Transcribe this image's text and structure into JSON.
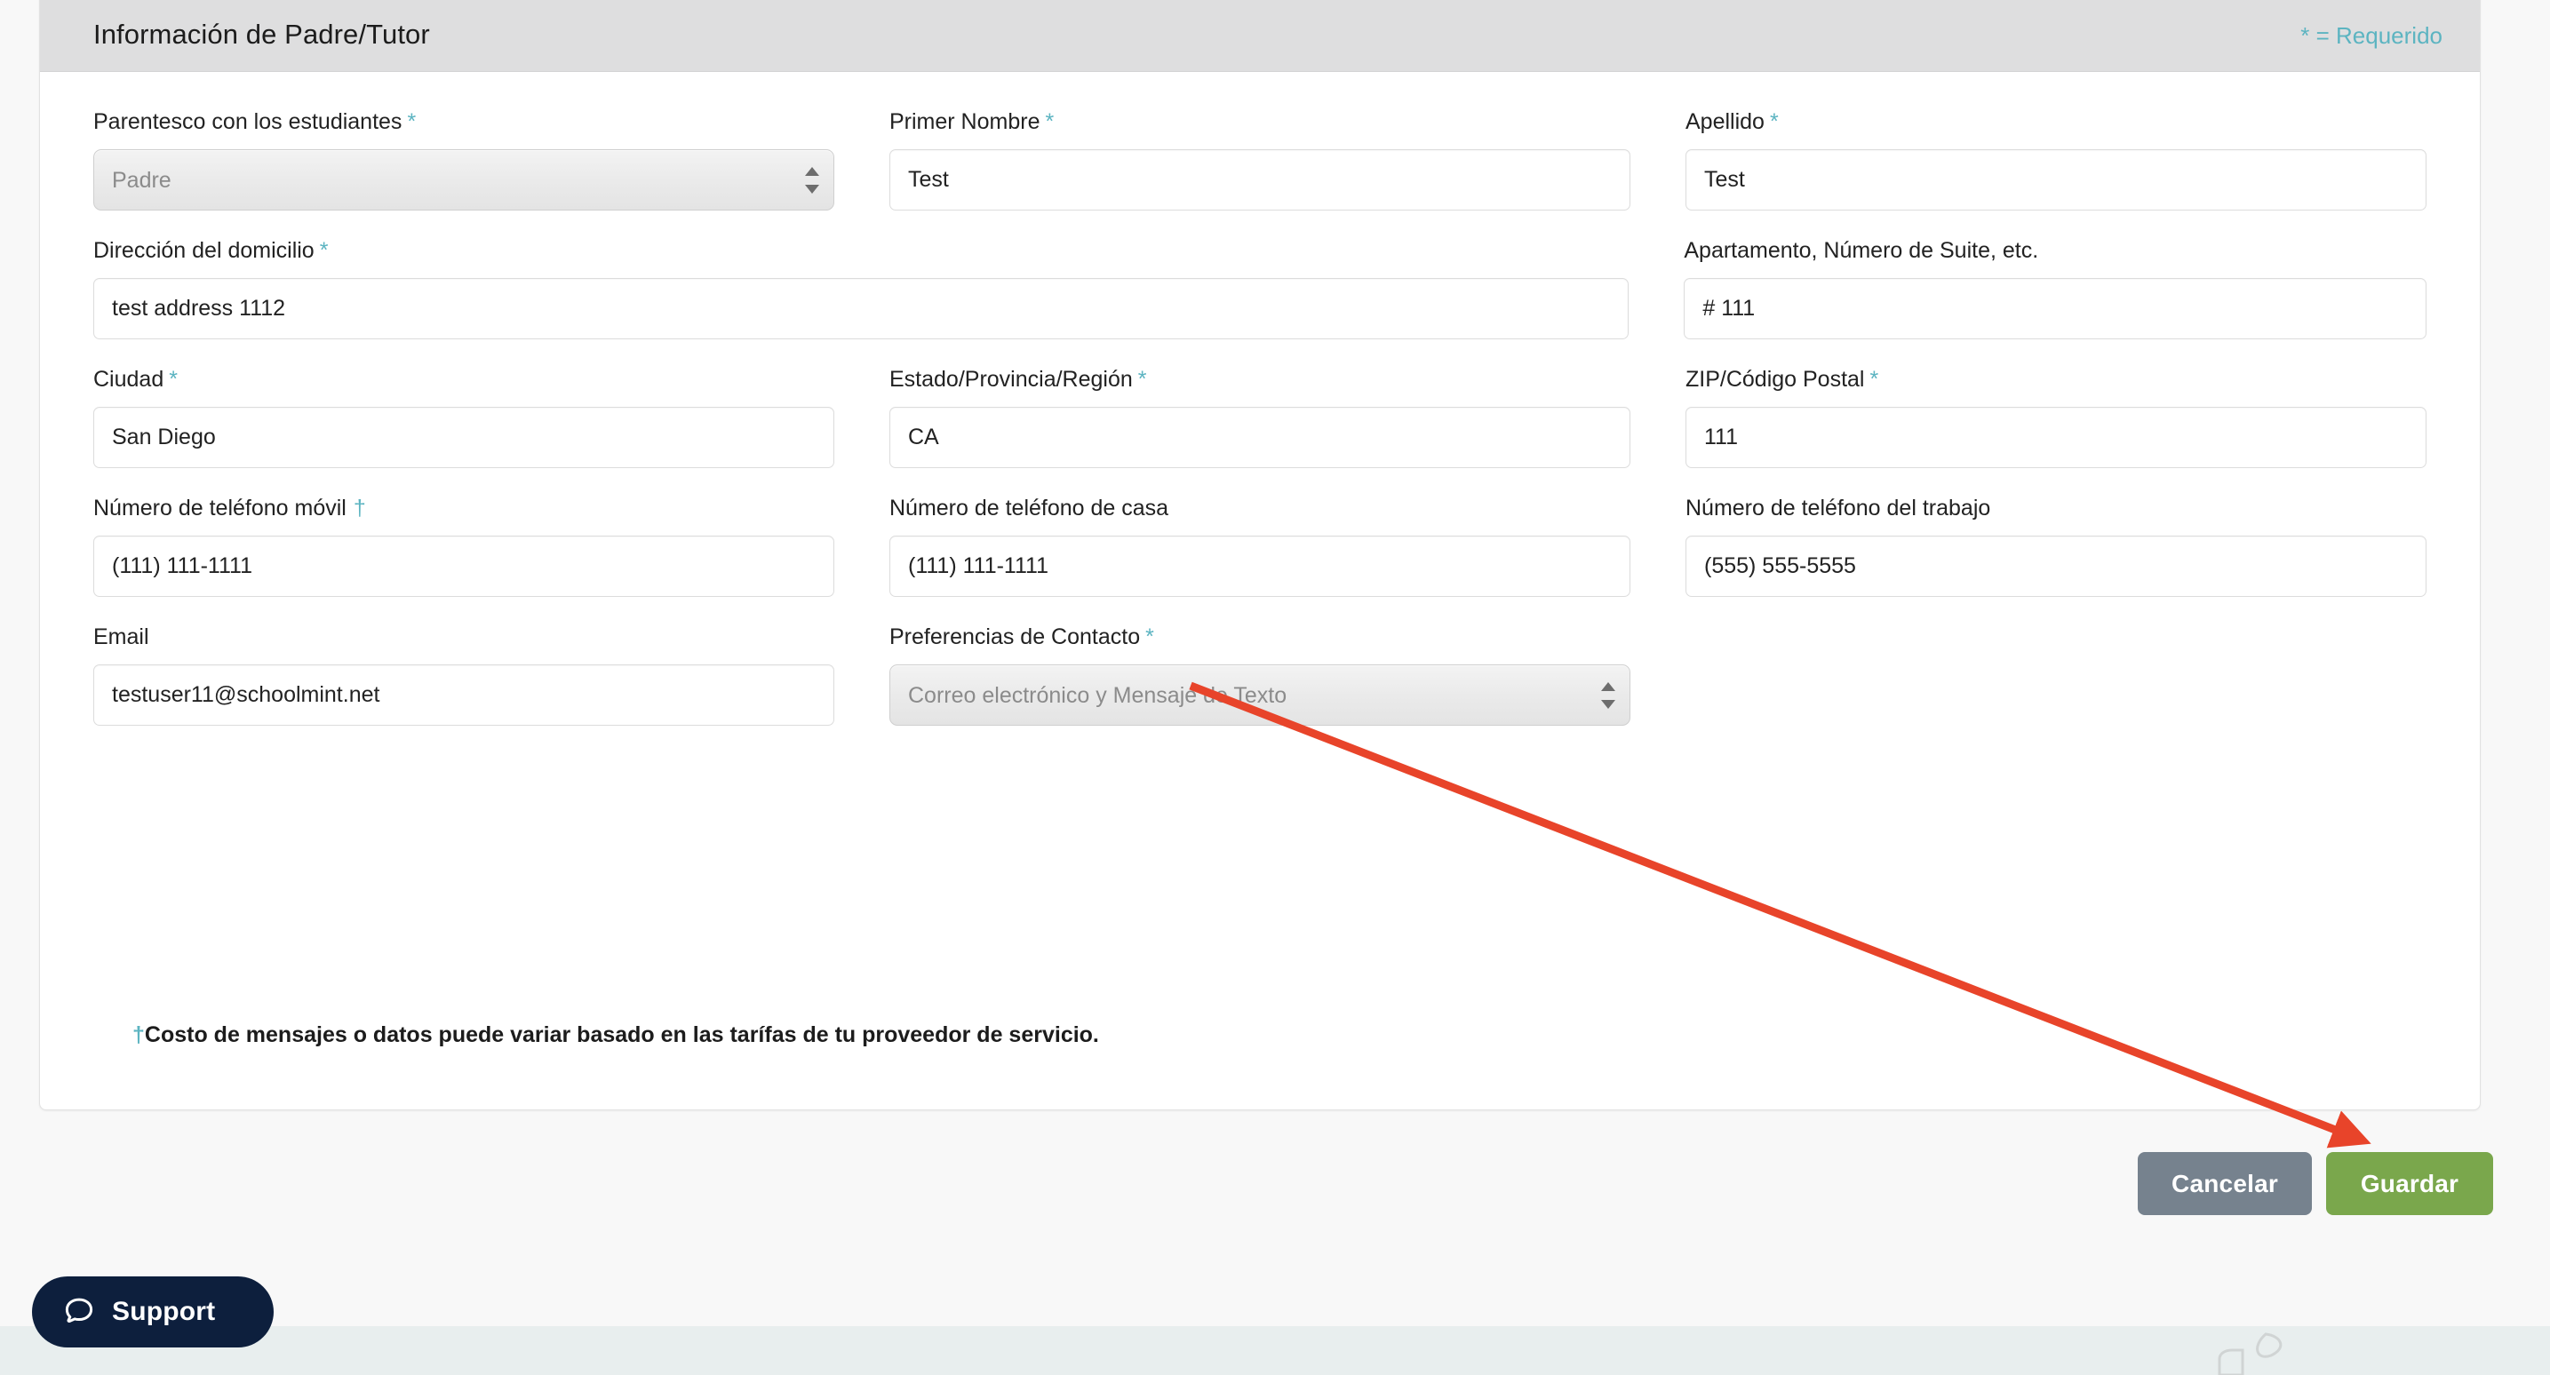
{
  "header": {
    "title": "Información de Padre/Tutor",
    "required_note": "* = Requerido"
  },
  "colors": {
    "accent_teal": "#5cb4c1",
    "header_bg": "#dededf",
    "cancel_button": "#76828e",
    "save_button": "#7aa74c",
    "annotation_arrow": "#e8442a",
    "support_bg": "#0d1f3d",
    "bottom_band": "#e8eeee"
  },
  "form": {
    "rows": [
      {
        "fields": [
          {
            "name": "relationship",
            "label": "Parentesco con los estudiantes",
            "marker": "*",
            "type": "select",
            "value": "Padre"
          },
          {
            "name": "first-name",
            "label": "Primer Nombre",
            "marker": "*",
            "type": "text",
            "value": "Test"
          },
          {
            "name": "last-name",
            "label": "Apellido",
            "marker": "*",
            "type": "text",
            "value": "Test"
          }
        ]
      },
      {
        "fields": [
          {
            "name": "home-address",
            "label": "Dirección del domicilio",
            "marker": "*",
            "type": "text",
            "value": "test address 1112"
          },
          {
            "name": "apartment",
            "label": "Apartamento, Número de Suite, etc.",
            "marker": "",
            "type": "text",
            "value": "# 111"
          }
        ]
      },
      {
        "fields": [
          {
            "name": "city",
            "label": "Ciudad",
            "marker": "*",
            "type": "text",
            "value": "San Diego"
          },
          {
            "name": "state",
            "label": "Estado/Provincia/Región",
            "marker": "*",
            "type": "text",
            "value": "CA"
          },
          {
            "name": "zip",
            "label": "ZIP/Código Postal",
            "marker": "*",
            "type": "text",
            "value": "111"
          }
        ]
      },
      {
        "fields": [
          {
            "name": "mobile-phone",
            "label": "Número de teléfono móvil",
            "marker": "†",
            "type": "text",
            "value": "(111) 111-1111"
          },
          {
            "name": "home-phone",
            "label": "Número de teléfono de casa",
            "marker": "",
            "type": "text",
            "value": "(111) 111-1111"
          },
          {
            "name": "work-phone",
            "label": "Número de teléfono del trabajo",
            "marker": "",
            "type": "text",
            "value": "(555) 555-5555"
          }
        ]
      },
      {
        "fields": [
          {
            "name": "email",
            "label": "Email",
            "marker": "",
            "type": "text",
            "value": "testuser11@schoolmint.net"
          },
          {
            "name": "contact-preferences",
            "label": "Preferencias de Contacto",
            "marker": "*",
            "type": "select",
            "value": "Correo electrónico y Mensaje de Texto"
          }
        ]
      }
    ],
    "footnote_dagger": "†",
    "footnote": "Costo de mensajes o datos puede variar basado en las tarífas de tu proveedor de servicio."
  },
  "footer": {
    "cancel_label": "Cancelar",
    "save_label": "Guardar"
  },
  "support": {
    "label": "Support",
    "icon": "chat-bubble-icon"
  }
}
